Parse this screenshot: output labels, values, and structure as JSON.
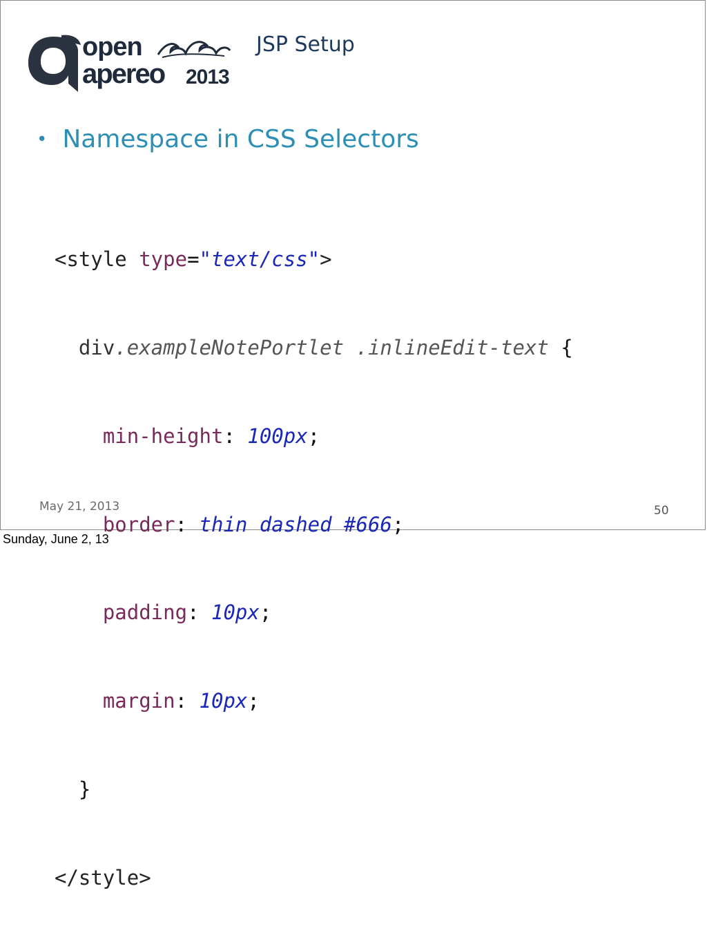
{
  "logo": {
    "open": "open",
    "apereo": "apereo",
    "year": "2013"
  },
  "slide": {
    "title": "JSP Setup",
    "bullet": "Namespace in CSS Selectors",
    "code": {
      "open_tag_start": "<style ",
      "attr": "type",
      "eq": "=",
      "attr_value": "\"text/css\"",
      "open_tag_end": ">",
      "selector_el": "div",
      "selector_cls": ".exampleNotePortlet .inlineEdit-text",
      "brace_open": "{",
      "decls": [
        {
          "prop": "min-height",
          "value": "100px"
        },
        {
          "prop": "border",
          "value": "thin dashed #666"
        },
        {
          "prop": "padding",
          "value": "10px"
        },
        {
          "prop": "margin",
          "value": "10px"
        }
      ],
      "brace_close": "}",
      "close_tag": "</style>"
    },
    "date": "May 21, 2013",
    "page_number": "50"
  },
  "caption": "Sunday, June 2, 13",
  "colors": {
    "title": "#1d3a5c",
    "bullet": "#2d8fb3",
    "code_value": "#1a27b8"
  }
}
